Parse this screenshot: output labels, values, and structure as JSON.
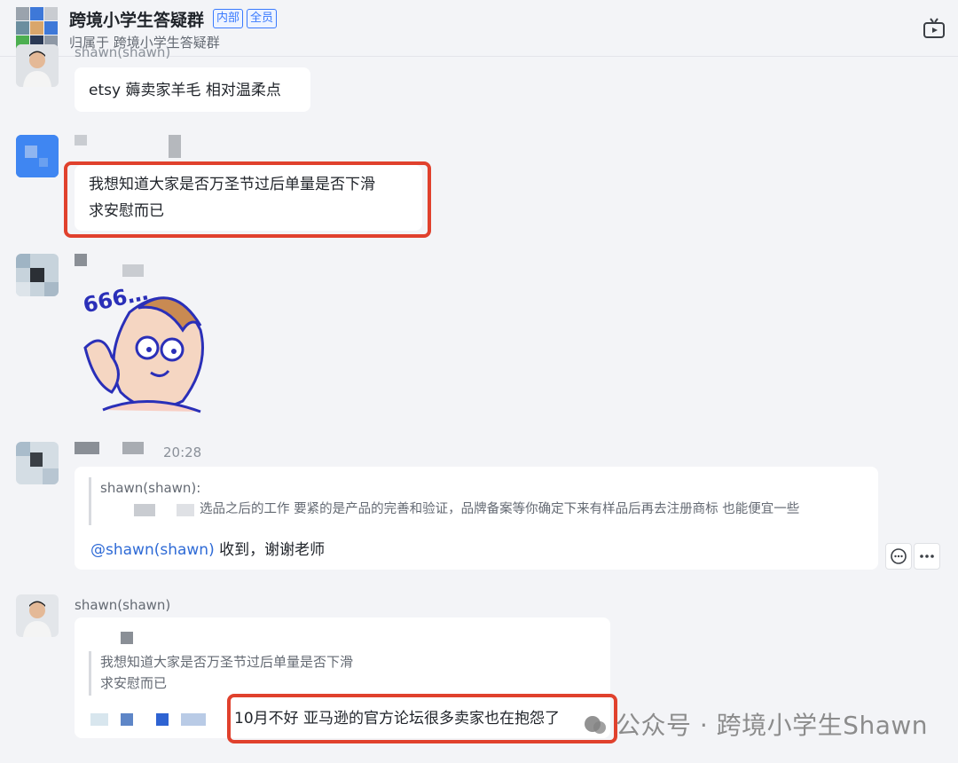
{
  "header": {
    "title": "跨境小学生答疑群",
    "tags": [
      "内部",
      "全员"
    ],
    "subtitle": "归属于 跨境小学生答疑群"
  },
  "messages": [
    {
      "sender": "shawn(shawn)",
      "text": "etsy 薅卖家羊毛 相对温柔点"
    },
    {
      "sender": "",
      "lines": [
        "我想知道大家是否万圣节过后单量是否下滑",
        "求安慰而已"
      ],
      "highlighted": true
    },
    {
      "sender": "",
      "sticker_text": "666…"
    },
    {
      "sender": "",
      "time": "20:28",
      "quote_author": "shawn(shawn):",
      "quote_text": "选品之后的工作 要紧的是产品的完善和验证，品牌备案等你确定下来有样品后再去注册商标 也能便宜一些",
      "mention": "@shawn(shawn)",
      "text": " 收到，谢谢老师"
    },
    {
      "sender": "shawn(shawn)",
      "quote_lines": [
        "我想知道大家是否万圣节过后单量是否下滑",
        "求安慰而已"
      ],
      "text": "10月不好 亚马逊的官方论坛很多卖家也在抱怨了",
      "highlighted": true
    }
  ],
  "watermark": "公众号 · 跨境小学生Shawn",
  "colors": {
    "accent": "#3a7afe",
    "highlight": "#e0412d",
    "mention": "#2f6bd6"
  }
}
